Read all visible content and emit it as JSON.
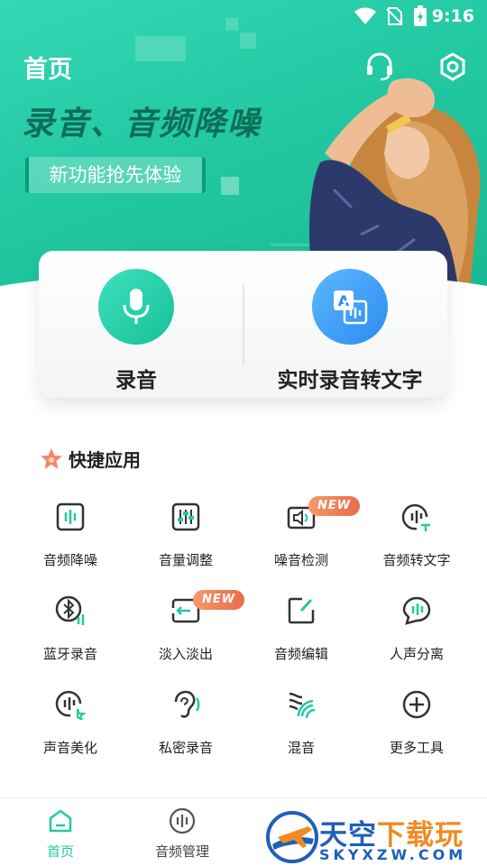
{
  "status_bar": {
    "time": "9:16",
    "icons": [
      "wifi-icon",
      "no-sim-icon",
      "battery-charging-icon"
    ]
  },
  "header": {
    "title": "首页",
    "icons": [
      "headset-icon",
      "settings-icon"
    ]
  },
  "banner": {
    "headline": "录音、音频降噪",
    "subline": "新功能抢先体验"
  },
  "actions": [
    {
      "label": "录音",
      "icon": "microphone-icon",
      "color": "#2bd0ad"
    },
    {
      "label": "实时录音转文字",
      "icon": "speech-to-text-icon",
      "color": "#3a9af5"
    }
  ],
  "quick_apps": {
    "title": "快捷应用",
    "items": [
      {
        "label": "音频降噪",
        "icon": "waveform-box-icon"
      },
      {
        "label": "音量调整",
        "icon": "sliders-icon"
      },
      {
        "label": "噪音检测",
        "icon": "speaker-box-icon",
        "badge": "NEW"
      },
      {
        "label": "音频转文字",
        "icon": "audio-to-text-icon"
      },
      {
        "label": "蓝牙录音",
        "icon": "bluetooth-icon"
      },
      {
        "label": "淡入淡出",
        "icon": "fade-icon",
        "badge": "NEW"
      },
      {
        "label": "音频编辑",
        "icon": "edit-icon"
      },
      {
        "label": "人声分离",
        "icon": "voice-bubble-icon"
      },
      {
        "label": "声音美化",
        "icon": "sound-magic-icon"
      },
      {
        "label": "私密录音",
        "icon": "ear-icon"
      },
      {
        "label": "混音",
        "icon": "mix-icon"
      },
      {
        "label": "更多工具",
        "icon": "plus-circle-icon"
      }
    ]
  },
  "bottom_nav": {
    "items": [
      {
        "label": "首页",
        "icon": "home-icon",
        "active": true
      },
      {
        "label": "音频管理",
        "icon": "audio-manage-icon",
        "active": false
      }
    ]
  },
  "watermark": {
    "title_blue": "天空",
    "title_orange": "下载玩",
    "domain": "SKYXZW.COM"
  },
  "colors": {
    "accent": "#22c9a3",
    "active_nav": "#22c9a3",
    "badge": "#e86c4c",
    "blue_action": "#3a9af5"
  }
}
